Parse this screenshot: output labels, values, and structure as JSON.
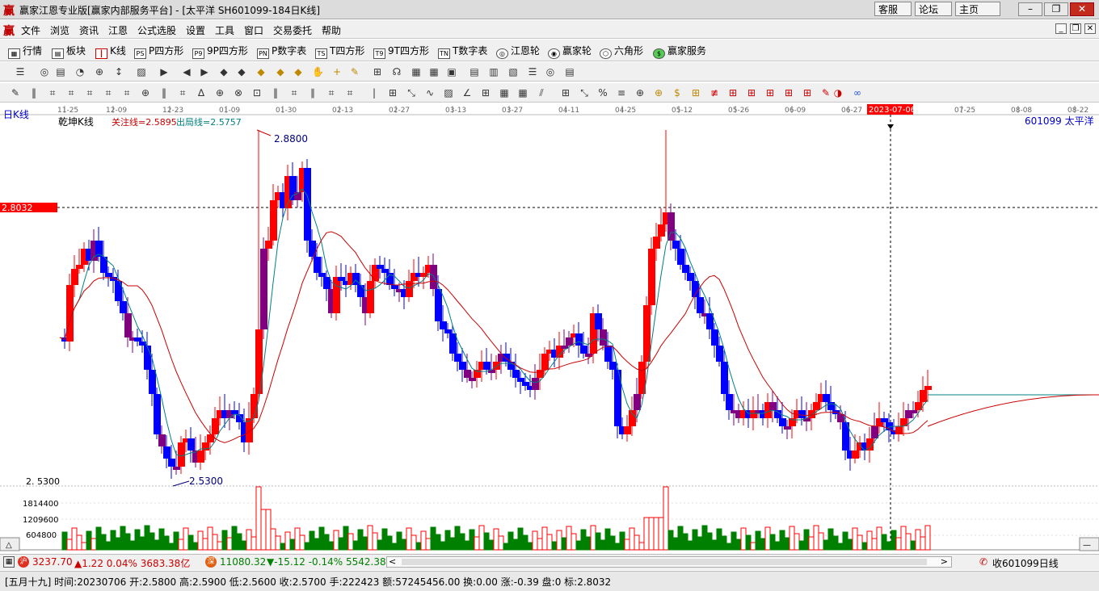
{
  "window": {
    "app_logo": "赢",
    "title": "赢家江恩专业版[赢家内部服务平台] - [太平洋  SH601099-184日K线]",
    "buttons": [
      "客服",
      "论坛",
      "主页"
    ]
  },
  "menu": {
    "logo": "赢",
    "items": [
      "文件",
      "浏览",
      "资讯",
      "江恩",
      "公式选股",
      "设置",
      "工具",
      "窗口",
      "交易委托",
      "帮助"
    ]
  },
  "nav": {
    "items": [
      {
        "label": "行情",
        "icon": "grid-icon"
      },
      {
        "label": "板块",
        "icon": "blocks-icon"
      },
      {
        "label": "K线",
        "icon": "candlestick-icon"
      },
      {
        "label": "P四方形",
        "icon": "ps-icon",
        "tag": "PS"
      },
      {
        "label": "9P四方形",
        "icon": "p9-icon",
        "tag": "P9"
      },
      {
        "label": "P数字表",
        "icon": "pn-icon",
        "tag": "PN"
      },
      {
        "label": "T四方形",
        "icon": "ts-icon",
        "tag": "TS"
      },
      {
        "label": "9T四方形",
        "icon": "t9-icon",
        "tag": "T9"
      },
      {
        "label": "T数字表",
        "icon": "tn-icon",
        "tag": "TN"
      },
      {
        "label": "江恩轮",
        "icon": "gann-wheel-icon"
      },
      {
        "label": "赢家轮",
        "icon": "winner-wheel-icon"
      },
      {
        "label": "六角形",
        "icon": "hexagon-icon"
      },
      {
        "label": "赢家服务",
        "icon": "dollar-icon"
      }
    ]
  },
  "chart": {
    "period_label": "日K线",
    "indicator_name": "乾坤K线",
    "focus_line": "关注线=2.5895",
    "exit_line": "出局线=2.5757",
    "stock_label": "601099  太平洋",
    "price_marker": "2.8032",
    "high_label": "2.8800",
    "low_label": "2.5300",
    "low_axis_label": "2. 5300",
    "cursor_date": "2023-07-06",
    "date_ticks": [
      "11-25",
      "12-09",
      "12-23",
      "01-09",
      "01-30",
      "02-13",
      "02-27",
      "03-13",
      "03-27",
      "04-11",
      "04-25",
      "05-12",
      "05-26",
      "06-09",
      "06-27",
      "07-25",
      "08-08",
      "08-22"
    ],
    "volume_ticks": [
      "1814400",
      "1209600",
      "604800"
    ],
    "colors": {
      "up": "#ff0000",
      "down": "#0000ff",
      "neutral": "#800080",
      "volume": "#008000",
      "ma_fast": "#008080",
      "ma_slow": "#cc0000"
    }
  },
  "chart_data": {
    "type": "candlestick",
    "price_range": [
      2.53,
      2.88
    ],
    "series": {
      "ohlc_sample": [
        {
          "x": "11-25",
          "open": 2.65,
          "high": 2.67,
          "low": 2.62,
          "close": 2.66
        },
        {
          "x": "12-23",
          "open": 2.56,
          "high": 2.57,
          "low": 2.53,
          "close": 2.54
        },
        {
          "x": "01-30",
          "open": 2.74,
          "high": 2.88,
          "low": 2.71,
          "close": 2.82
        },
        {
          "x": "05-12",
          "open": 2.8,
          "high": 2.86,
          "low": 2.76,
          "close": 2.79
        },
        {
          "x": "07-06",
          "open": 2.58,
          "high": 2.59,
          "low": 2.56,
          "close": 2.57
        }
      ]
    }
  },
  "status": {
    "sh_index": "3237.70",
    "sh_change": "▲1.22 0.04% 3683.38亿",
    "sz_index": "11080.32",
    "sz_change": "▼-15.12 -0.14% 5542.38",
    "right_label": "收601099日线"
  },
  "info": {
    "text": "[五月十九] 时间:20230706 开:2.5800 高:2.5900 低:2.5600 收:2.5700 手:222423 额:57245456.00 换:0.00 涨:-0.39 盘:0 标:2.8032"
  }
}
